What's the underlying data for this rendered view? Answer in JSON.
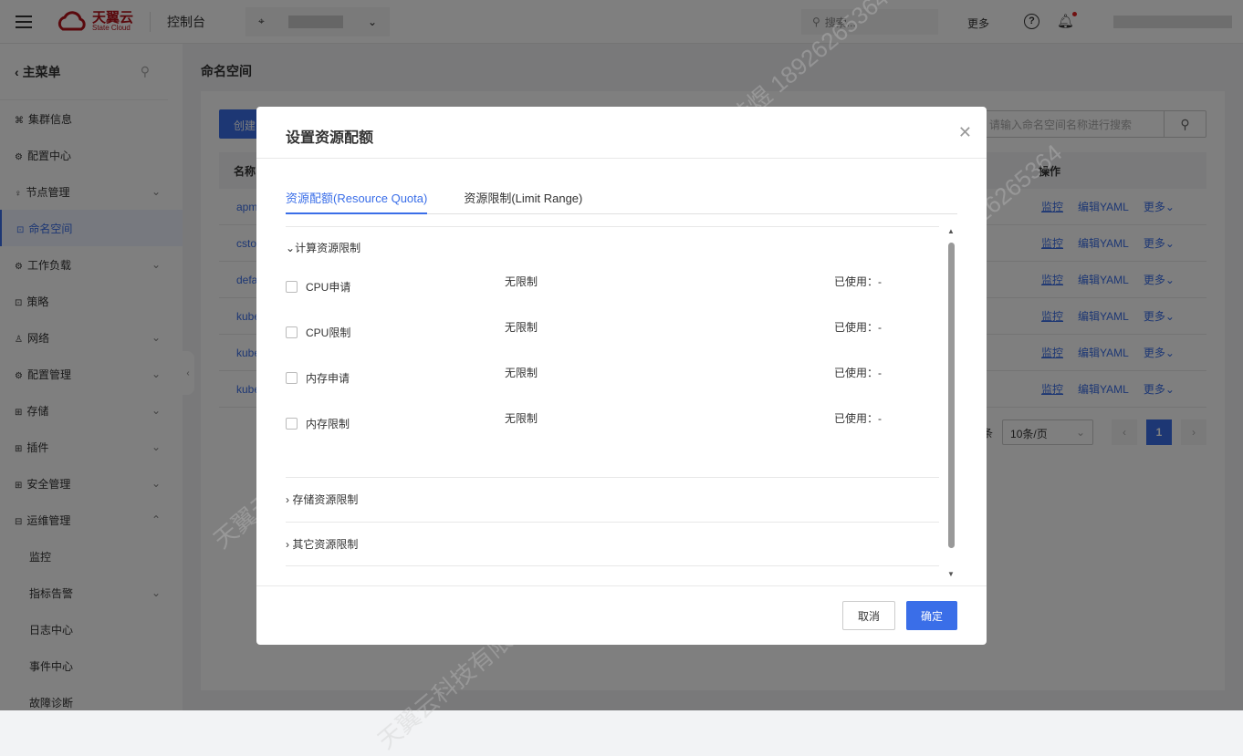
{
  "header": {
    "console": "控制台",
    "search_placeholder": "搜索...",
    "more": "更多",
    "logo_cn": "天翼云",
    "logo_en": "State Cloud"
  },
  "sidebar": {
    "title": "主菜单",
    "items": [
      {
        "label": "集群信息",
        "icon": "⌘",
        "expand": false
      },
      {
        "label": "配置中心",
        "icon": "⚙",
        "expand": false
      },
      {
        "label": "节点管理",
        "icon": "♀",
        "expand": true
      },
      {
        "label": "命名空间",
        "icon": "⊡",
        "expand": false,
        "active": true
      },
      {
        "label": "工作负载",
        "icon": "⚙",
        "expand": true
      },
      {
        "label": "策略",
        "icon": "⊡",
        "expand": false
      },
      {
        "label": "网络",
        "icon": "♙",
        "expand": true
      },
      {
        "label": "配置管理",
        "icon": "⚙",
        "expand": true
      },
      {
        "label": "存储",
        "icon": "⊞",
        "expand": true
      },
      {
        "label": "插件",
        "icon": "⊞",
        "expand": true
      },
      {
        "label": "安全管理",
        "icon": "⊞",
        "expand": true
      },
      {
        "label": "运维管理",
        "icon": "⊟",
        "expand": true,
        "open": true
      }
    ],
    "sub": [
      {
        "label": "监控"
      },
      {
        "label": "指标告警",
        "expand": true
      },
      {
        "label": "日志中心"
      },
      {
        "label": "事件中心"
      },
      {
        "label": "故障诊断"
      }
    ]
  },
  "main": {
    "title": "命名空间",
    "create": "创建",
    "search_placeholder": "请输入命名空间名称进行搜索",
    "col_name": "名称",
    "col_ops": "操作",
    "rows": [
      {
        "name": "apm"
      },
      {
        "name": "csto"
      },
      {
        "name": "defa"
      },
      {
        "name": "kube"
      },
      {
        "name": "kube"
      },
      {
        "name": "kube"
      }
    ],
    "op_monitor": "监控",
    "op_edit": "编辑YAML",
    "op_more": "更多",
    "page_unit": "条",
    "page_size": "10条/页",
    "page": "1"
  },
  "modal": {
    "title": "设置资源配额",
    "tabs": [
      "资源配额(Resource Quota)",
      "资源限制(Limit Range)"
    ],
    "compute": "计算资源限制",
    "storage": "存储资源限制",
    "other": "其它资源限制",
    "quotas": [
      {
        "name": "CPU申请",
        "limit": "无限制",
        "used": "已使用：-"
      },
      {
        "name": "CPU限制",
        "limit": "无限制",
        "used": "已使用：-"
      },
      {
        "name": "内存申请",
        "limit": "无限制",
        "used": "已使用：-"
      },
      {
        "name": "内存限制",
        "limit": "无限制",
        "used": "已使用：-"
      }
    ],
    "cancel": "取消",
    "confirm": "确定"
  },
  "watermark": "天翼云科技有限公司 徐桂煜 18926265364",
  "colors": {
    "accent": "#3a6ee8",
    "brand": "#b5121b"
  }
}
